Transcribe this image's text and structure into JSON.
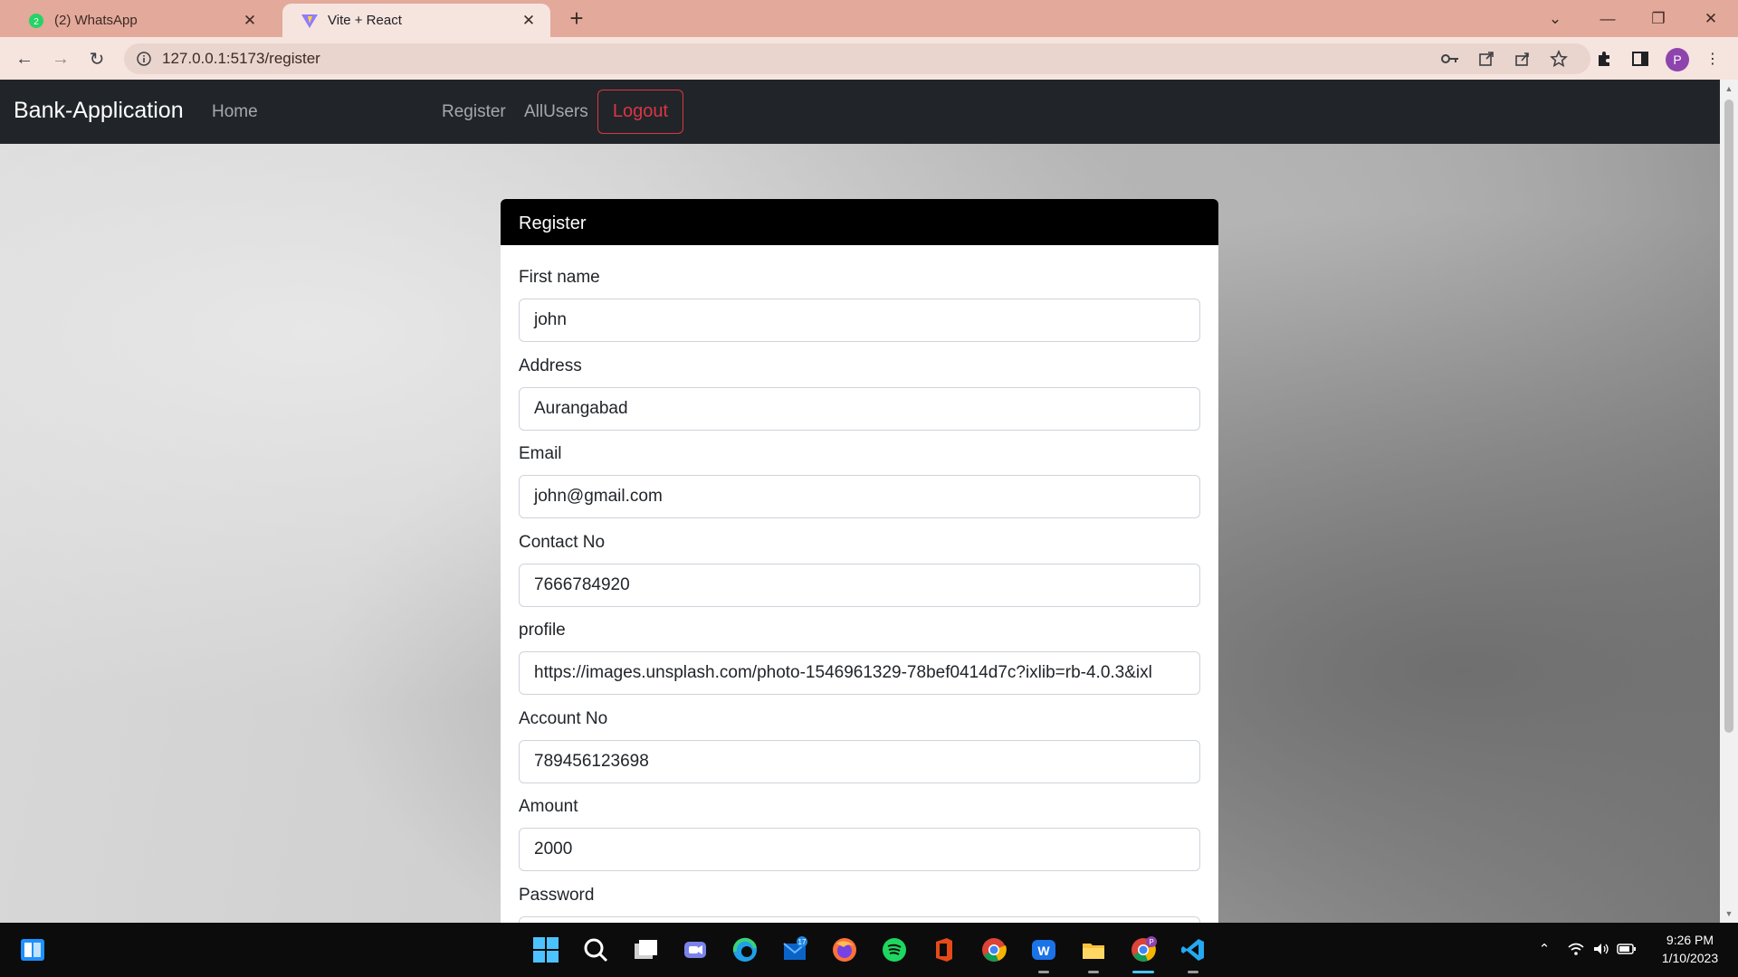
{
  "browser": {
    "tabs": [
      {
        "title": "(2) WhatsApp",
        "icon": "whatsapp-icon",
        "active": false
      },
      {
        "title": "Vite + React",
        "icon": "vite-icon",
        "active": true
      }
    ],
    "url": "127.0.0.1:5173/register",
    "profile_initial": "P"
  },
  "navbar": {
    "brand": "Bank-Application",
    "links": [
      "Home",
      "Register",
      "AllUsers"
    ],
    "logout_label": "Logout"
  },
  "form": {
    "title": "Register",
    "fields": [
      {
        "label": "First name",
        "value": "john"
      },
      {
        "label": "Address",
        "value": "Aurangabad"
      },
      {
        "label": "Email",
        "value": "john@gmail.com"
      },
      {
        "label": "Contact No",
        "value": "7666784920"
      },
      {
        "label": "profile",
        "value": "https://images.unsplash.com/photo-1546961329-78bef0414d7c?ixlib=rb-4.0.3&ixl"
      },
      {
        "label": "Account No",
        "value": "789456123698"
      },
      {
        "label": "Amount",
        "value": "2000"
      },
      {
        "label": "Password",
        "value": ""
      }
    ]
  },
  "taskbar": {
    "time": "9:26 PM",
    "date": "1/10/2023",
    "mail_badge": "17",
    "chrome_badge": "P",
    "apps": [
      "windows-start-icon",
      "task-view-icon",
      "search-icon",
      "file-explorer-icon",
      "teams-icon",
      "edge-icon",
      "mail-icon",
      "firefox-icon",
      "spotify-icon",
      "office-icon",
      "chrome-icon",
      "webstorm-icon",
      "folder-icon",
      "chrome-profile-icon",
      "vscode-icon"
    ]
  },
  "colors": {
    "tabbar": "#e3a99a",
    "toolbar": "#f6e4df",
    "navbar": "#212529",
    "logout": "#dc3545",
    "card_header": "#000000"
  }
}
